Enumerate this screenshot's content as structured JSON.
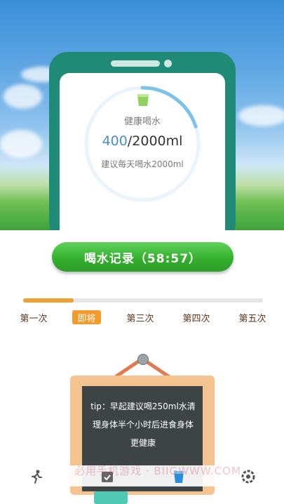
{
  "hero": {
    "card_label": "健康喝水",
    "current_amount": "400",
    "target_amount": "/2000ml",
    "advice": "建议每天喝水2000ml",
    "intake_fraction": 0.2
  },
  "record_button": {
    "label": "喝水记录（58:57）"
  },
  "progress": {
    "fraction": 0.21
  },
  "steps": [
    {
      "label": "第一次",
      "active": false
    },
    {
      "label": "即将",
      "active": true
    },
    {
      "label": "第三次",
      "active": false
    },
    {
      "label": "第四次",
      "active": false
    },
    {
      "label": "第五次",
      "active": false
    }
  ],
  "tip": {
    "text": "tip：早起建议喝250ml水清理身体半个小时后进食身体更健康"
  },
  "tabs": [
    {
      "icon": "run-icon"
    },
    {
      "icon": "calendar-icon"
    },
    {
      "icon": "water-cup-icon"
    },
    {
      "icon": "settings-icon"
    }
  ],
  "watermark": "必用手机游戏 · BIIGWWW.COM",
  "colors": {
    "accent_orange": "#f59a2c",
    "accent_green": "#35b02f",
    "ring_blue": "#7cc3ea",
    "phone_teal": "#1f8b76"
  }
}
